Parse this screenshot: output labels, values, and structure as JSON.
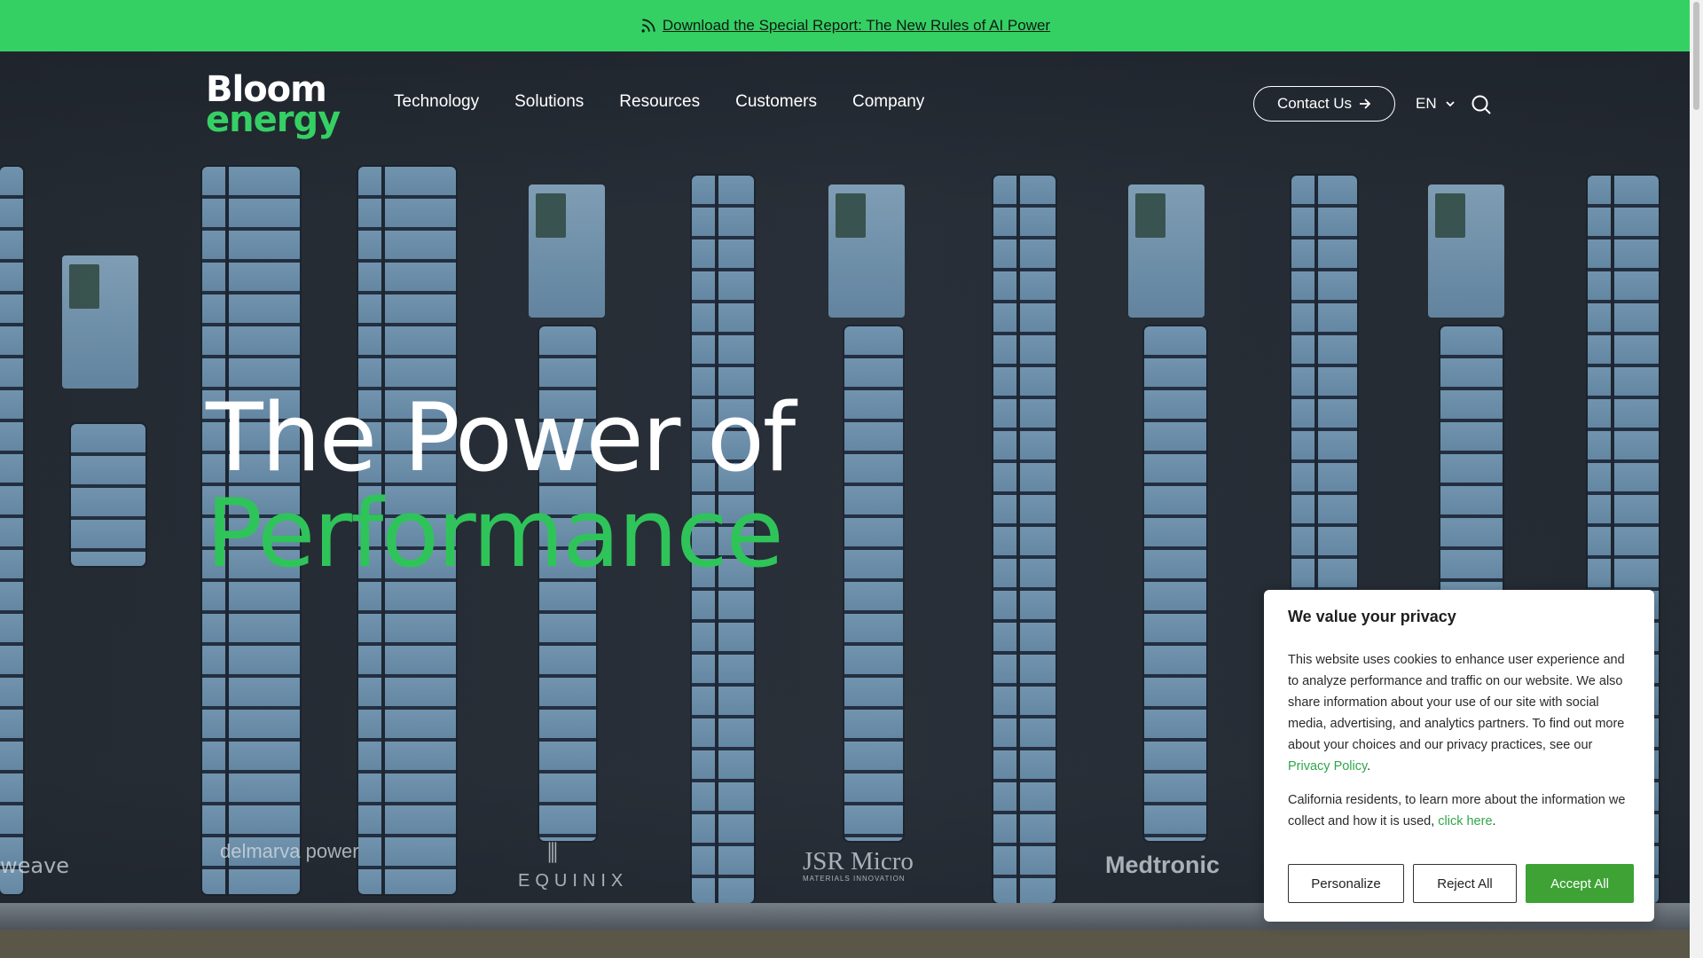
{
  "announcement": {
    "text": "Download the Special Report: The New Rules of AI Power"
  },
  "logo": {
    "line1": "Bloom",
    "line2": "energy"
  },
  "nav": {
    "items": [
      "Technology",
      "Solutions",
      "Resources",
      "Customers",
      "Company"
    ]
  },
  "header": {
    "contact_label": "Contact Us",
    "language": "EN"
  },
  "hero": {
    "line1": "The Power of",
    "line2": "Performance"
  },
  "customer_logos": {
    "weave": "weave",
    "delmarva": "delmarva power",
    "equinix": "EQUINIX",
    "jsr": "JSR Micro",
    "jsr_sub": "MATERIALS INNOVATION",
    "medtronic": "Medtronic"
  },
  "cookie": {
    "title": "We value your privacy",
    "body_text": "This website uses cookies to enhance user experience and to analyze performance and traffic on our website. We also share information about your use of our site with social media, advertising, and analytics partners.  To find out more about your choices and our privacy practices, see our ",
    "privacy_link": "Privacy Policy",
    "body_end": ".",
    "ca_text": "California residents, to learn more about the information we collect and how it is used, ",
    "ca_link": "click here",
    "ca_end": ".",
    "personalize": "Personalize",
    "reject": "Reject All",
    "accept": "Accept All"
  },
  "colors": {
    "brand_green": "#35d064",
    "accept_green": "#3ea235",
    "link_green": "#2fa64b"
  },
  "icons": [
    "rss-icon",
    "arrow-right-icon",
    "chevron-down-icon",
    "search-icon"
  ]
}
